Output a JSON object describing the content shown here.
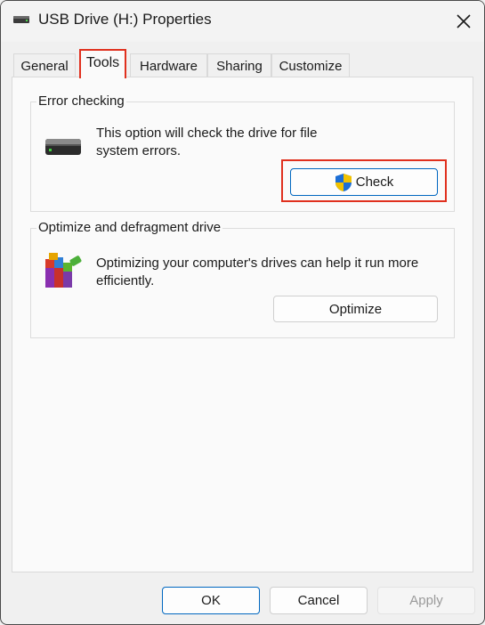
{
  "window": {
    "title": "USB Drive (H:) Properties"
  },
  "tabs": [
    {
      "label": "General"
    },
    {
      "label": "Tools"
    },
    {
      "label": "Hardware"
    },
    {
      "label": "Sharing"
    },
    {
      "label": "Customize"
    }
  ],
  "error_checking": {
    "group_label": "Error checking",
    "description": "This option will check the drive for file system errors.",
    "button_label": "Check"
  },
  "optimize": {
    "group_label": "Optimize and defragment drive",
    "description": "Optimizing your computer's drives can help it run more efficiently.",
    "button_label": "Optimize"
  },
  "footer": {
    "ok_label": "OK",
    "cancel_label": "Cancel",
    "apply_label": "Apply"
  },
  "colors": {
    "highlight": "#e0301e",
    "accent": "#0067c0"
  },
  "icons": [
    "drive-icon",
    "close-icon",
    "hard-drive-icon",
    "uac-shield-icon",
    "defrag-icon"
  ]
}
